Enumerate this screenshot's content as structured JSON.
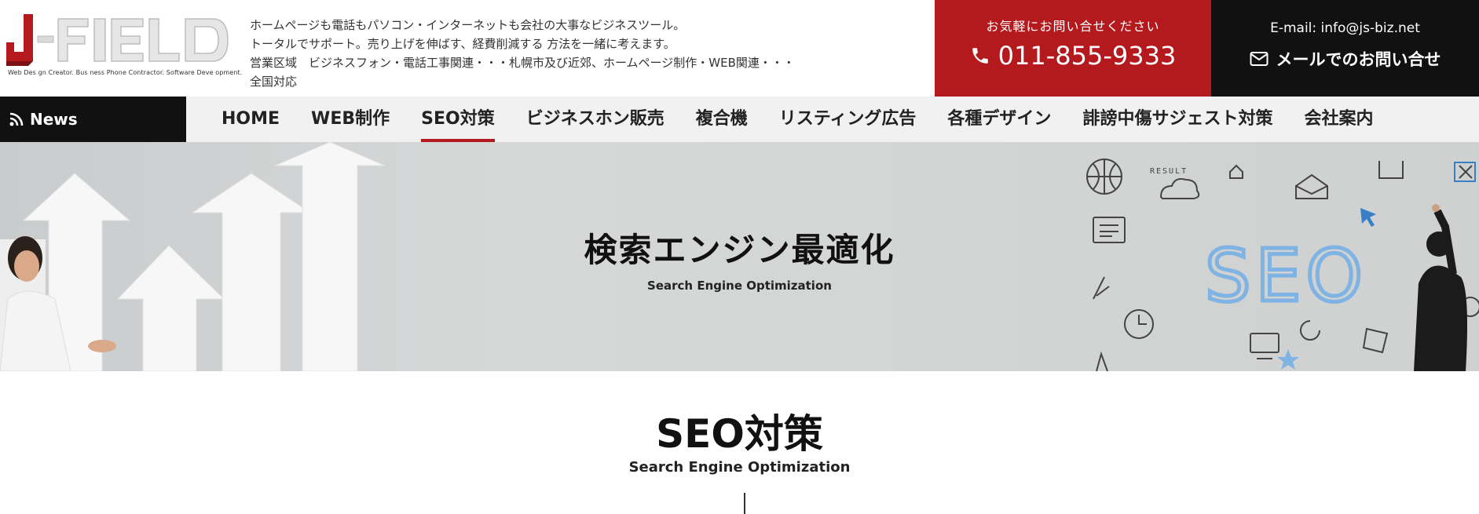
{
  "brand": {
    "logo_text": "J-FIELD",
    "tagline": "Web Des gn Creator.   Bus ness Phone Contractor.   Software Deve opment."
  },
  "intro": {
    "lines": [
      "ホームページも電話もパソコン・インターネットも会社の大事なビジネスツール。",
      "トータルでサポート。売り上げを伸ばす、経費削減する 方法を一緒に考えます。",
      "営業区域　ビジネスフォン・電話工事関連・・・札幌市及び近郊、ホームページ制作・WEB関連・・・",
      "全国対応"
    ]
  },
  "contact": {
    "phone_lead": "お気軽にお問い合せください",
    "phone": "011-855-9333",
    "email_label": "E-mail: info@js-biz.net",
    "mail_button": "メールでのお問い合せ"
  },
  "nav": {
    "news_label": "News",
    "items": [
      {
        "label": "HOME",
        "active": false
      },
      {
        "label": "WEB制作",
        "active": false
      },
      {
        "label": "SEO対策",
        "active": true
      },
      {
        "label": "ビジネスホン販売",
        "active": false
      },
      {
        "label": "複合機",
        "active": false
      },
      {
        "label": "リスティング広告",
        "active": false
      },
      {
        "label": "各種デザイン",
        "active": false
      },
      {
        "label": "誹謗中傷サジェスト対策",
        "active": false
      },
      {
        "label": "会社案内",
        "active": false
      }
    ]
  },
  "hero": {
    "title": "検索エンジン最適化",
    "subtitle": "Search Engine Optimization",
    "art_text_seo": "SEO",
    "art_text_result": "RESULT"
  },
  "section": {
    "title": "SEO対策",
    "subtitle": "Search Engine Optimization"
  },
  "colors": {
    "accent_red": "#b3191d",
    "dark": "#111111",
    "nav_bg": "#f1f1f1",
    "seo_blue": "#7eb3e3"
  },
  "icons": [
    "rss-icon",
    "phone-icon",
    "envelope-icon"
  ]
}
